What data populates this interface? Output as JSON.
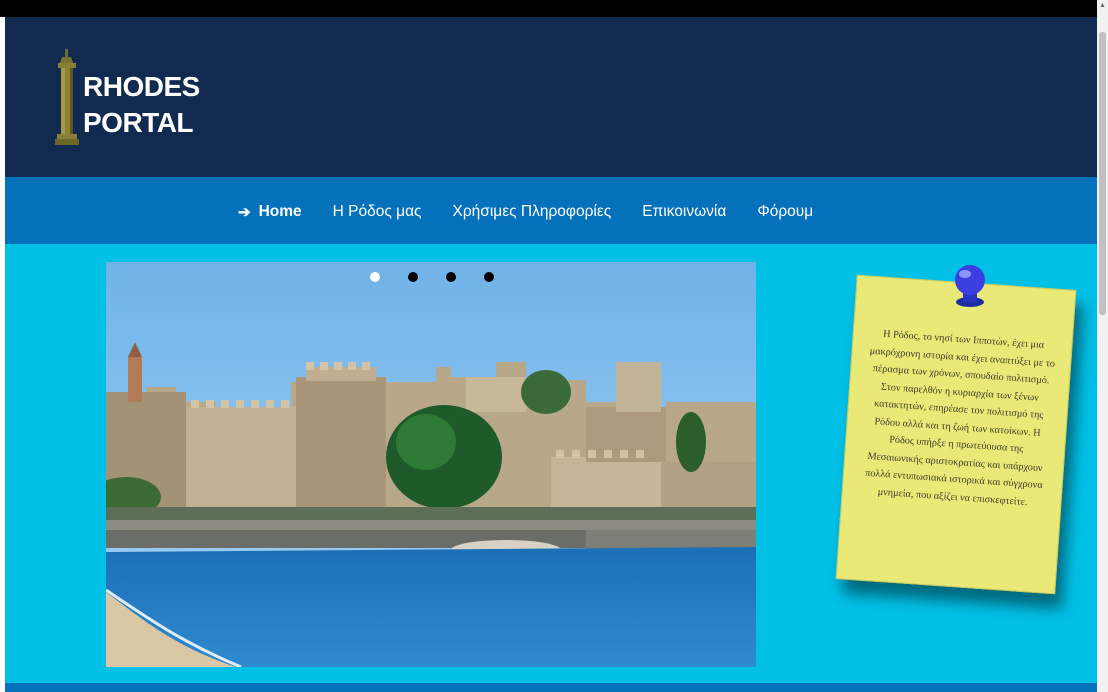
{
  "logo": {
    "line1": "RHODES",
    "line2": "PORTAL"
  },
  "nav": {
    "items": [
      {
        "label": "Home",
        "active": true,
        "icon": "arrow-right-icon"
      },
      {
        "label": "Η Ρόδος μας"
      },
      {
        "label": "Χρήσιμες Πληροφορίες"
      },
      {
        "label": "Επικοινωνία"
      },
      {
        "label": "Φόρουμ"
      }
    ]
  },
  "slider": {
    "slide_count": 4,
    "active_slide": 1
  },
  "note": {
    "text": "Η Ρόδος, το νησί των Ιπποτών, έχει μια μακρόχρονη ιστορία και έχει αναπτύξει με το πέρασμα των χρόνων, σπουδαίο πολιτισμό. Στον παρελθόν η κυριαρχία των ξένων κατακτητών, επηρέασε τον πολιτισμό της Ρόδου αλλά και τη ζωή των κατοίκων. Η Ρόδος υπήρξε η πρωτεύουσα της Μεσαιωνικής αριστοκρατίας και υπάρχουν πολλά εντυπωσιακά ιστορικά και σύγχρονα μνημεία, που αξίζει να επισκεφτείτε."
  },
  "colors": {
    "header_bg": "#132a50",
    "nav_bg": "#0571bb",
    "main_bg": "#00c0e6",
    "note_bg": "#e9e978",
    "pin": "#3b3fe0"
  }
}
